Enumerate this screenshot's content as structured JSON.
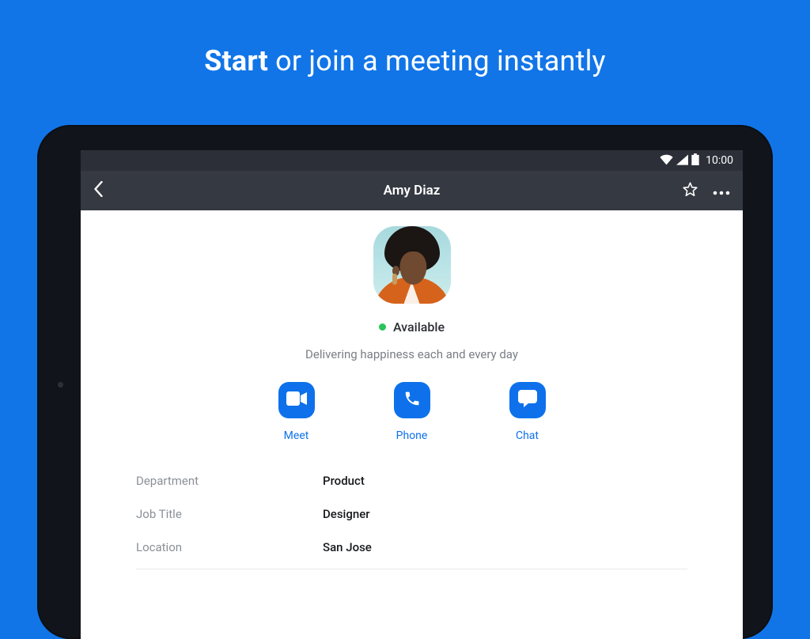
{
  "marketing": {
    "bold": "Start",
    "rest": " or join a meeting instantly"
  },
  "status_bar": {
    "time": "10:00"
  },
  "app_bar": {
    "title": "Amy Diaz"
  },
  "profile": {
    "presence": "Available",
    "tagline": "Delivering happiness each and every day"
  },
  "actions": {
    "meet": "Meet",
    "phone": "Phone",
    "chat": "Chat"
  },
  "details": {
    "department_label": "Department",
    "department_value": "Product",
    "jobtitle_label": "Job Title",
    "jobtitle_value": "Designer",
    "location_label": "Location",
    "location_value": "San Jose"
  }
}
